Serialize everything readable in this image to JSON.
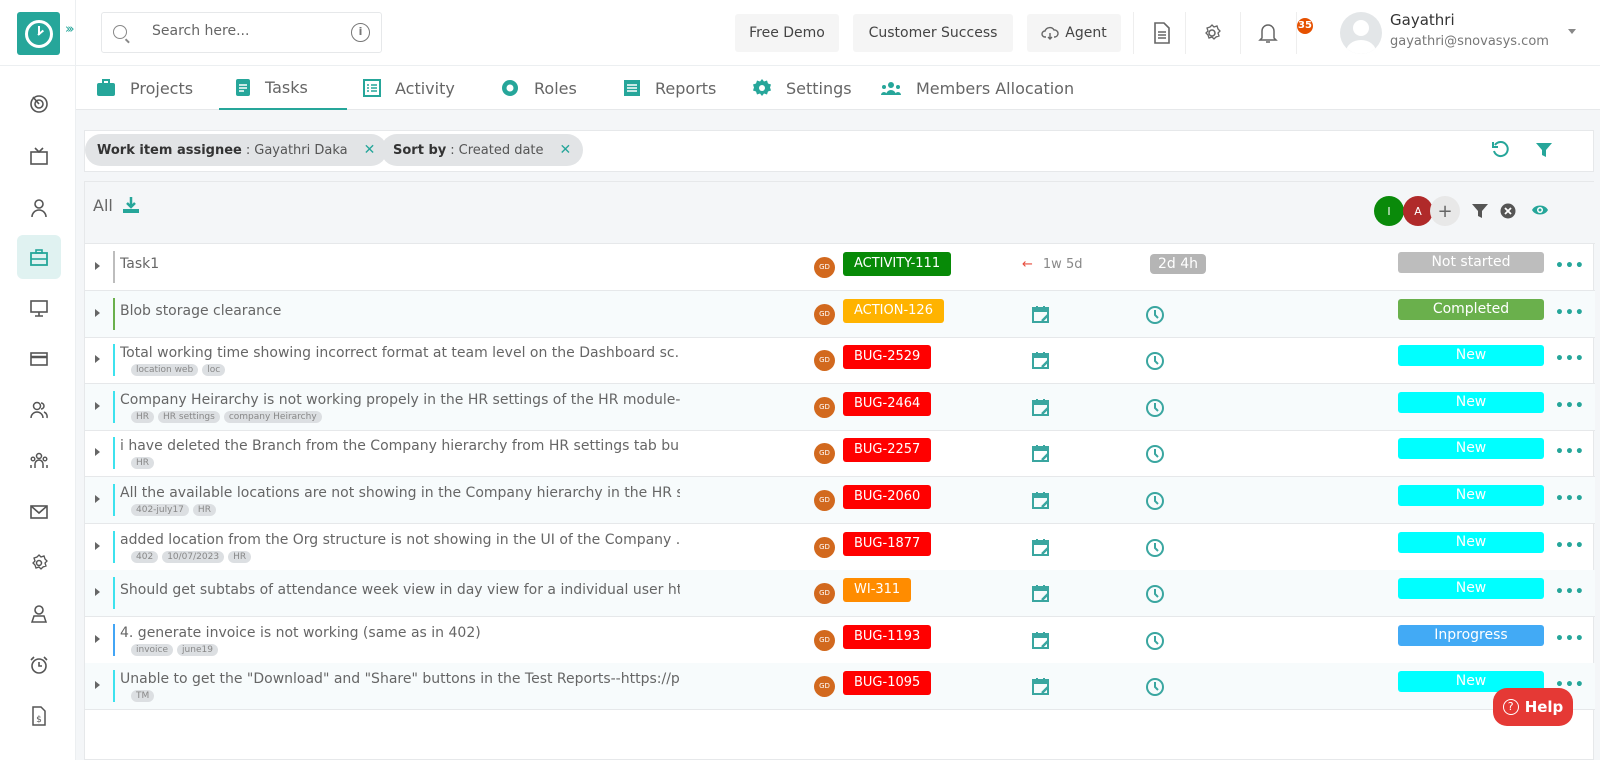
{
  "header": {
    "search_placeholder": "Search here...",
    "buttons": {
      "free_demo": "Free Demo",
      "customer_success": "Customer Success",
      "agent": "Agent"
    },
    "notification_count": "35",
    "user": {
      "name": "Gayathri",
      "email": "gayathri@snovasys.com"
    }
  },
  "tabs": [
    {
      "label": "Projects"
    },
    {
      "label": "Tasks",
      "active": true
    },
    {
      "label": "Activity"
    },
    {
      "label": "Roles"
    },
    {
      "label": "Reports"
    },
    {
      "label": "Settings"
    },
    {
      "label": "Members Allocation"
    }
  ],
  "filters": [
    {
      "key": "Work item assignee",
      "value": "Gayathri Daka"
    },
    {
      "key": "Sort by",
      "value": "Created date"
    }
  ],
  "list": {
    "header_label": "All",
    "avatars": [
      {
        "initial": "I",
        "color": "#0a8a0a"
      },
      {
        "initial": "A",
        "color": "#b02a2a"
      },
      {
        "initial": "+",
        "color": "#e8e8e8"
      }
    ],
    "rows": [
      {
        "title": "Task1",
        "tags": [],
        "assignee": "GD",
        "key": "ACTIVITY-111",
        "key_color": "#078a07",
        "bar_color": "#bdbdbd",
        "estimate": "1w 5d",
        "spent": "2d 4h",
        "status": "Not started",
        "status_color": "#bdbdbd"
      },
      {
        "title": "Blob storage clearance",
        "tags": [],
        "assignee": "GD",
        "key": "ACTION-126",
        "key_color": "#ffb300",
        "bar_color": "#6ab04c",
        "status": "Completed",
        "status_color": "#6ab04c"
      },
      {
        "title": "Total working time showing incorrect format at team level on the Dashboard sc...",
        "tags": [
          "location web",
          "loc"
        ],
        "assignee": "GD",
        "key": "BUG-2529",
        "key_color": "#ff0000",
        "bar_color": "#3de2ee",
        "status": "New",
        "status_color": "#00ffff"
      },
      {
        "title": "Company Heirarchy is not working propely in the HR settings of the HR module-...",
        "tags": [
          "HR",
          "HR settings",
          "company Heirarchy"
        ],
        "assignee": "GD",
        "key": "BUG-2464",
        "key_color": "#ff0000",
        "bar_color": "#3de2ee",
        "status": "New",
        "status_color": "#00ffff"
      },
      {
        "title": "i have deleted the Branch from the Company hierarchy from HR settings tab bu...",
        "tags": [
          "HR"
        ],
        "assignee": "GD",
        "key": "BUG-2257",
        "key_color": "#ff0000",
        "bar_color": "#3de2ee",
        "status": "New",
        "status_color": "#00ffff"
      },
      {
        "title": "All the available locations are not showing in the Company hierarchy in the HR s...",
        "tags": [
          "402-july17",
          "HR"
        ],
        "assignee": "GD",
        "key": "BUG-2060",
        "key_color": "#ff0000",
        "bar_color": "#3de2ee",
        "status": "New",
        "status_color": "#00ffff"
      },
      {
        "title": "added location from the Org structure is not showing in the UI of the Company ...",
        "tags": [
          "402",
          "10/07/2023",
          "HR"
        ],
        "assignee": "GD",
        "key": "BUG-1877",
        "key_color": "#ff0000",
        "bar_color": "#3de2ee",
        "status": "New",
        "status_color": "#00ffff"
      },
      {
        "title": "Should get subtabs of attendance week view in day view for a individual user ht...",
        "tags": [],
        "assignee": "GD",
        "key": "WI-311",
        "key_color": "#ff8c00",
        "bar_color": "#3de2ee",
        "status": "New",
        "status_color": "#00ffff"
      },
      {
        "title": "4. generate invoice is not working (same as in 402)",
        "tags": [
          "invoice",
          "june19"
        ],
        "assignee": "GD",
        "key": "BUG-1193",
        "key_color": "#ff0000",
        "bar_color": "#42a5f5",
        "status": "Inprogress",
        "status_color": "#42aaf5"
      },
      {
        "title": "Unable to get the \"Download\" and \"Share\" buttons in the Test Reports--https://p...",
        "tags": [
          "TM"
        ],
        "assignee": "GD",
        "key": "BUG-1095",
        "key_color": "#ff0000",
        "bar_color": "#3de2ee",
        "status": "New",
        "status_color": "#00ffff"
      }
    ]
  },
  "help_label": "Help"
}
